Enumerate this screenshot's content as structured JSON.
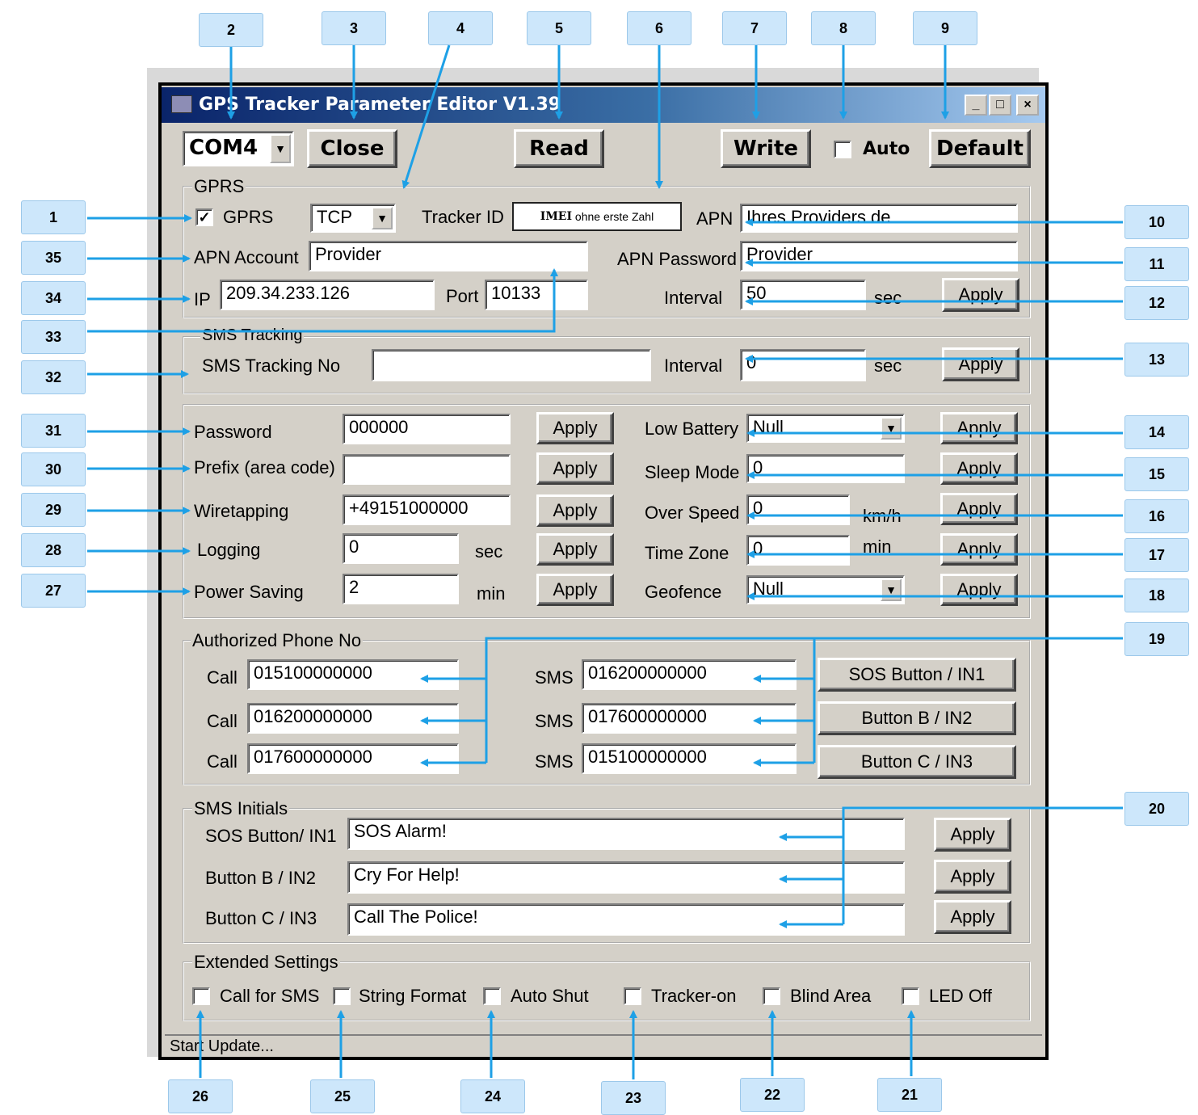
{
  "window": {
    "title": "GPS Tracker Parameter Editor V1.39",
    "controls": [
      "_",
      "□",
      "×"
    ],
    "status": "Start Update..."
  },
  "toolbar": {
    "com_port": "COM4",
    "close": "Close",
    "read": "Read",
    "write": "Write",
    "auto_label": "Auto",
    "auto_checked": false,
    "default": "Default"
  },
  "gprs": {
    "group": "GPRS",
    "gprs_label": "GPRS",
    "gprs_checked": true,
    "protocol": "TCP",
    "tracker_id_label": "Tracker ID",
    "tracker_id_bold": "IMEI",
    "tracker_id_rest": "ohne erste Zahl",
    "apn_label": "APN",
    "apn_value": "Ihres Providers.de",
    "apn_account_label": "APN Account",
    "apn_account_value": "Provider",
    "apn_password_label": "APN Password",
    "apn_password_value": "Provider",
    "ip_label": "IP",
    "ip_value": "209.34.233.126",
    "port_label": "Port",
    "port_value": "10133",
    "interval_label": "Interval",
    "interval_value": "50",
    "interval_unit": "sec",
    "apply": "Apply"
  },
  "sms_tracking": {
    "group": "SMS Tracking",
    "number_label": "SMS Tracking No",
    "number_value": "",
    "interval_label": "Interval",
    "interval_value": "0",
    "interval_unit": "sec",
    "apply": "Apply"
  },
  "settings": {
    "apply": "Apply",
    "password_label": "Password",
    "password_value": "000000",
    "prefix_label": "Prefix (area code)",
    "prefix_value": "",
    "wiretapping_label": "Wiretapping",
    "wiretapping_value": "+49151000000",
    "logging_label": "Logging",
    "logging_value": "0",
    "logging_unit": "sec",
    "power_label": "Power Saving",
    "power_value": "2",
    "power_unit": "min",
    "low_battery_label": "Low Battery",
    "low_battery_value": "Null",
    "sleep_label": "Sleep Mode",
    "sleep_value": "0",
    "overspeed_label": "Over Speed",
    "overspeed_value": "0",
    "overspeed_unit": "km/h",
    "timezone_label": "Time Zone",
    "timezone_value": "0",
    "timezone_unit": "min",
    "geofence_label": "Geofence",
    "geofence_value": "Null"
  },
  "authorized": {
    "group": "Authorized Phone No",
    "call_label": "Call",
    "sms_label": "SMS",
    "calls": [
      "015100000000",
      "016200000000",
      "017600000000"
    ],
    "sms": [
      "016200000000",
      "017600000000",
      "015100000000"
    ],
    "buttons": [
      "SOS Button / IN1",
      "Button B / IN2",
      "Button C / IN3"
    ]
  },
  "sms_initials": {
    "group": "SMS Initials",
    "labels": [
      "SOS Button/ IN1",
      "Button B / IN2",
      "Button C / IN3"
    ],
    "values": [
      "SOS Alarm!",
      "Cry For Help!",
      "Call The Police!"
    ],
    "apply": "Apply"
  },
  "extended": {
    "group": "Extended Settings",
    "options": [
      "Call for SMS",
      "String Format",
      "Auto Shut",
      "Tracker-on",
      "Blind Area",
      "LED Off"
    ],
    "checked": [
      false,
      false,
      false,
      false,
      false,
      false
    ]
  },
  "callouts": {
    "top": [
      "2",
      "3",
      "4",
      "5",
      "6",
      "7",
      "8",
      "9"
    ],
    "right": [
      "10",
      "11",
      "12",
      "13",
      "14",
      "15",
      "16",
      "17",
      "18",
      "19",
      "20"
    ],
    "bottom": [
      "26",
      "25",
      "24",
      "23",
      "22",
      "21"
    ],
    "left": [
      "1",
      "35",
      "34",
      "33",
      "32",
      "31",
      "30",
      "29",
      "28",
      "27"
    ]
  },
  "colors": {
    "window": "#d4d0c8",
    "title": "#0a246a",
    "callout": "#cde7fb",
    "arrow": "#1ea0e6"
  }
}
